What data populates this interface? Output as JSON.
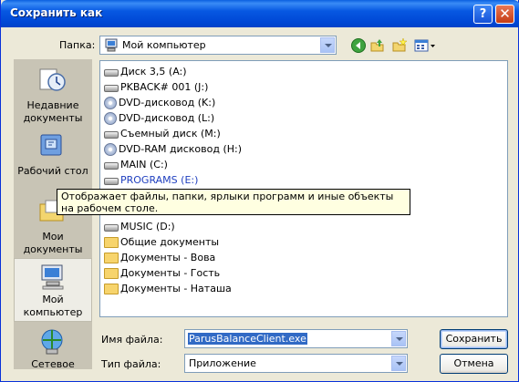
{
  "window": {
    "title": "Сохранить как",
    "help_glyph": "?",
    "close_glyph": "✕"
  },
  "lookin": {
    "label": "Папка:",
    "value": "Мой компьютер"
  },
  "places": [
    {
      "label": "Недавние документы",
      "icon": "recent-documents-icon"
    },
    {
      "label": "Рабочий стол",
      "icon": "desktop-icon"
    },
    {
      "label": "Мои документы",
      "icon": "my-documents-icon"
    },
    {
      "label": "Мой компьютер",
      "icon": "my-computer-icon"
    },
    {
      "label": "Сетевое",
      "icon": "network-icon"
    }
  ],
  "files": [
    {
      "name": "Диск 3,5 (A:)",
      "icon": "floppy-icon"
    },
    {
      "name": "PKBACK# 001 (J:)",
      "icon": "drive-icon"
    },
    {
      "name": "DVD-дисковод (K:)",
      "icon": "cd-icon"
    },
    {
      "name": "DVD-дисковод (L:)",
      "icon": "cd-icon"
    },
    {
      "name": "Съемный диск (M:)",
      "icon": "drive-icon"
    },
    {
      "name": "DVD-RAM дисковод (H:)",
      "icon": "cd-icon"
    },
    {
      "name": "MAIN (C:)",
      "icon": "drive-icon"
    },
    {
      "name": "PROGRAMS (E:)",
      "icon": "drive-icon"
    },
    {
      "name": "MUSIC (D:)",
      "icon": "drive-icon"
    },
    {
      "name": "Общие документы",
      "icon": "folder-icon"
    },
    {
      "name": "Документы - Вова",
      "icon": "folder-icon"
    },
    {
      "name": "Документы - Гость",
      "icon": "folder-icon"
    },
    {
      "name": "Документы - Наташа",
      "icon": "folder-icon"
    }
  ],
  "tooltip": "Отображает файлы, папки, ярлыки программ и иные объекты на рабочем столе.",
  "filename": {
    "label": "Имя файла:",
    "value": "ParusBalanceClient.exe"
  },
  "filetype": {
    "label": "Тип файла:",
    "value": "Приложение"
  },
  "buttons": {
    "save": "Сохранить",
    "cancel": "Отмена"
  },
  "colors": {
    "titlebar": "#0048d6",
    "dialog_bg": "#ece9d8",
    "selection": "#316ac5",
    "highlight_text": "#1f3fbf"
  }
}
